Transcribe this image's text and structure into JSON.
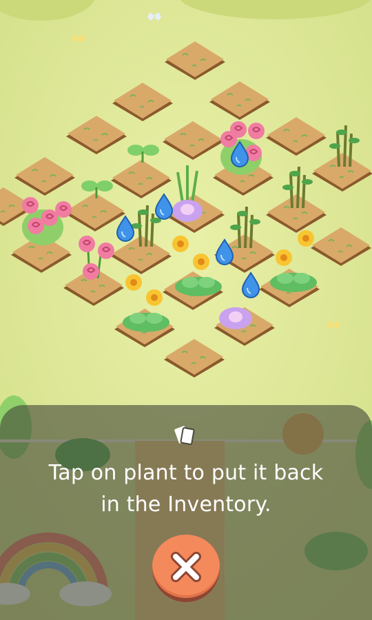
{
  "scene": {
    "name": "garden-plot-grid",
    "colors": {
      "grass": "#dfe99a",
      "soil": "#d9a96a",
      "soil_edge": "#8a5a2c",
      "water_drop": "#3f93e8",
      "overlay": "#464a3a"
    },
    "water_drop_count": 5
  },
  "tutorial": {
    "icon": "cards-icon",
    "line1": "Tap on plant to put it back",
    "line2": "in the Inventory."
  },
  "close_button": {
    "icon": "close-icon",
    "color": "#f4895c"
  }
}
